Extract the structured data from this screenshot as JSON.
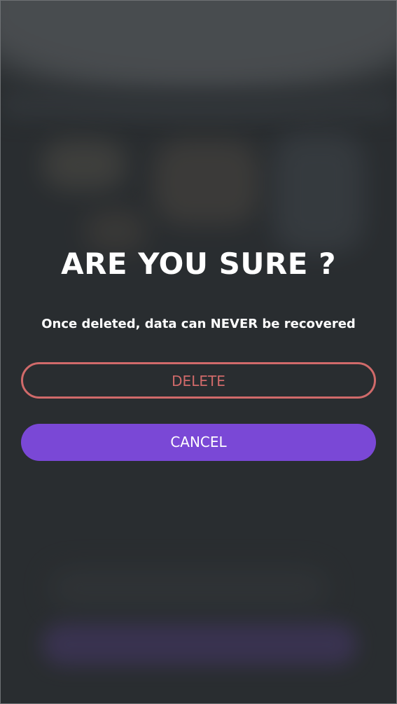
{
  "dialog": {
    "title": "ARE YOU SURE ?",
    "message": "Once deleted, data can NEVER be recovered",
    "delete_label": "DELETE",
    "cancel_label": "CANCEL"
  },
  "colors": {
    "delete_accent": "#d06a6a",
    "cancel_bg": "#7a48d6",
    "background": "#2f3336",
    "text": "#ffffff"
  }
}
